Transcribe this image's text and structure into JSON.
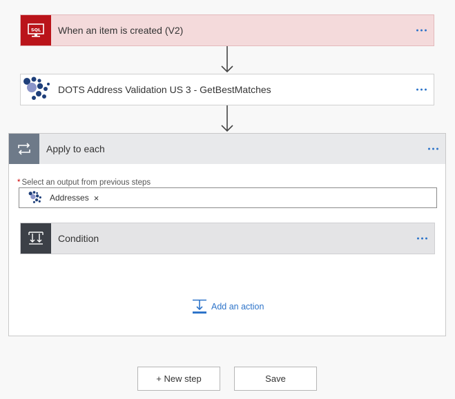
{
  "steps": [
    {
      "title": "When an item is created (V2)",
      "icon": "sql-icon",
      "icon_text": "SQL",
      "accent": "#ba141a",
      "header_bg": "#f4dadb"
    },
    {
      "title": "DOTS Address Validation US 3 - GetBestMatches",
      "icon": "service-objects-logo-icon",
      "header_bg": "#ffffff"
    }
  ],
  "apply_each": {
    "title": "Apply to each",
    "icon": "loop-icon",
    "icon_bg": "#6e7a89",
    "header_bg": "#e8e9eb",
    "field_label": "Select an output from previous steps",
    "required_mark": "*",
    "token_label": "Addresses",
    "token_remove": "×",
    "condition": {
      "title": "Condition",
      "icon": "condition-icon",
      "icon_bg": "#3c4047",
      "header_bg": "#e4e4e6"
    },
    "add_action_label": "Add an action"
  },
  "buttons": {
    "new_step": "+ New step",
    "save": "Save"
  },
  "colors": {
    "link": "#2e74c9"
  }
}
